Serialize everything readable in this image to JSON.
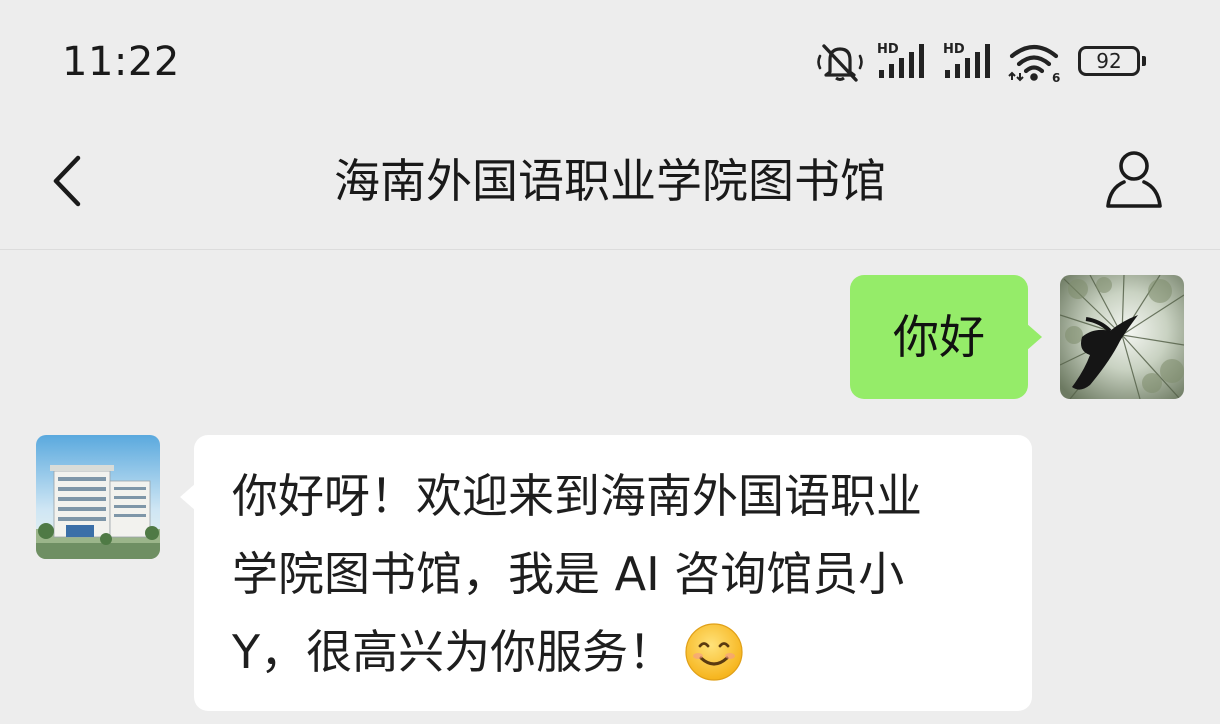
{
  "status_bar": {
    "time": "11:22",
    "icons": [
      "mute-icon",
      "hd-signal-icon",
      "hd-signal-icon",
      "wifi-icon"
    ],
    "battery": "92"
  },
  "header": {
    "title": "海南外国语职业学院图书馆",
    "back_icon": "chevron-left-icon",
    "profile_icon": "user-icon"
  },
  "chat": {
    "messages": [
      {
        "direction": "outgoing",
        "text": "你好"
      },
      {
        "direction": "incoming",
        "lines": [
          "你好呀！欢迎来到海南外国语职业",
          "学院图书馆，我是 AI 咨询馆员小",
          "Y，很高兴为你服务！"
        ],
        "emoji": "smile-emoji"
      }
    ]
  },
  "colors": {
    "background": "#ededed",
    "outgoing_bubble": "#95ec69",
    "incoming_bubble": "#ffffff"
  }
}
